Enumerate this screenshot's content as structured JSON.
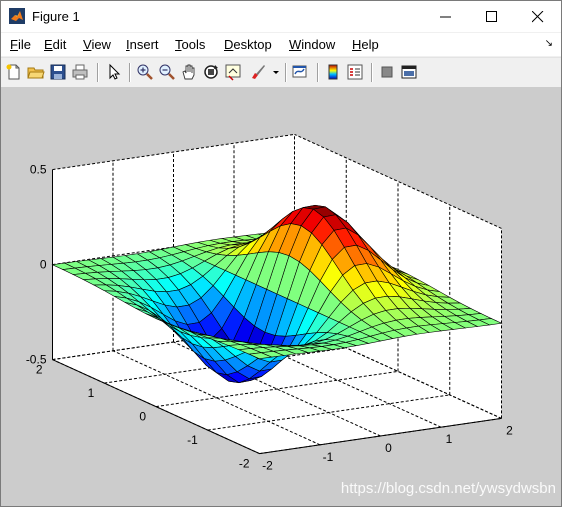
{
  "window": {
    "title": "Figure 1"
  },
  "menu": [
    "File",
    "Edit",
    "View",
    "Insert",
    "Tools",
    "Desktop",
    "Window",
    "Help"
  ],
  "toolbar": {
    "items": [
      "new-figure-icon",
      "open-file-icon",
      "save-icon",
      "print-icon",
      "edit-plot-arrow-icon",
      "zoom-in-icon",
      "zoom-out-icon",
      "pan-hand-icon",
      "rotate-3d-icon",
      "data-cursor-icon",
      "brush-icon",
      "link-plot-icon",
      "colorbar-icon",
      "legend-icon",
      "hide-plot-tools-icon",
      "show-plot-tools-icon"
    ]
  },
  "chart_data": {
    "type": "surface",
    "function": "z = x*exp(-x^2 - y^2)",
    "x": [
      -2,
      2
    ],
    "y": [
      -2,
      2
    ],
    "zlim": [
      -0.5,
      0.5
    ],
    "grid": true,
    "colormap": "jet",
    "x_ticks": [
      "-2",
      "-1",
      "0",
      "1",
      "2"
    ],
    "y_ticks": [
      "-2",
      "-1",
      "0",
      "1",
      "2"
    ],
    "z_ticks": [
      "-0.5",
      "0",
      "0.5"
    ]
  },
  "watermark": "https://blog.csdn.net/ywsydwsbn"
}
